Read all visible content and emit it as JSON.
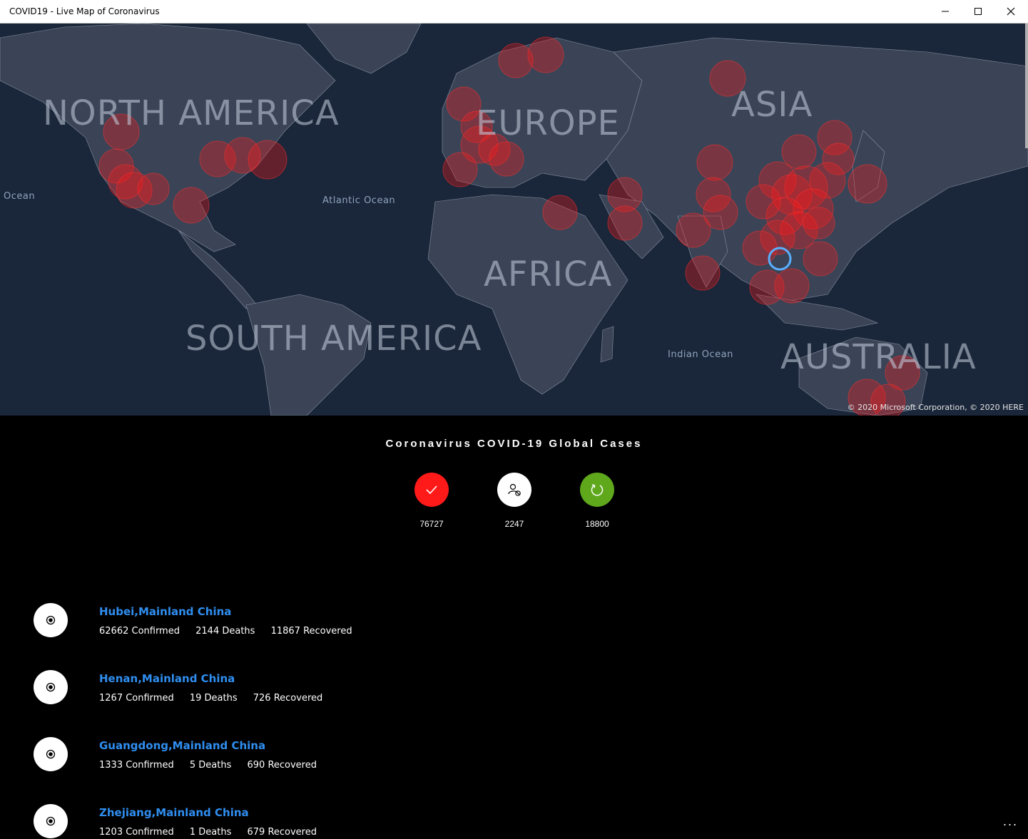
{
  "window": {
    "title": "COVID19 - Live Map of Coronavirus"
  },
  "map": {
    "continents": [
      "NORTH AMERICA",
      "EUROPE",
      "ASIA",
      "AFRICA",
      "SOUTH AMERICA",
      "AUSTRALIA"
    ],
    "oceans": [
      "Ocean",
      "Atlantic Ocean",
      "Indian Ocean"
    ],
    "copyright": "© 2020 Microsoft Corporation, © 2020 HERE",
    "colors": {
      "water": "#1a2639",
      "land": "#3a4456",
      "hotspot": "#ff1a1a"
    }
  },
  "summary": {
    "title": "Coronavirus COVID-19 Global Cases",
    "confirmed": {
      "value": "76727",
      "icon": "check-icon",
      "color": "#ff1a1a"
    },
    "deaths": {
      "value": "2247",
      "icon": "person-blocked-icon",
      "color": "#ffffff"
    },
    "recovered": {
      "value": "18800",
      "icon": "refresh-icon",
      "color": "#5fa81c"
    }
  },
  "regions": [
    {
      "name": "Hubei,Mainland China",
      "confirmed": "62662 Confirmed",
      "deaths": "2144 Deaths",
      "recovered": "11867 Recovered"
    },
    {
      "name": "Henan,Mainland China",
      "confirmed": "1267 Confirmed",
      "deaths": "19 Deaths",
      "recovered": "726 Recovered"
    },
    {
      "name": "Guangdong,Mainland China",
      "confirmed": "1333 Confirmed",
      "deaths": "5 Deaths",
      "recovered": "690 Recovered"
    },
    {
      "name": "Zhejiang,Mainland China",
      "confirmed": "1203 Confirmed",
      "deaths": "1 Deaths",
      "recovered": "679 Recovered"
    }
  ],
  "more_button": "..."
}
